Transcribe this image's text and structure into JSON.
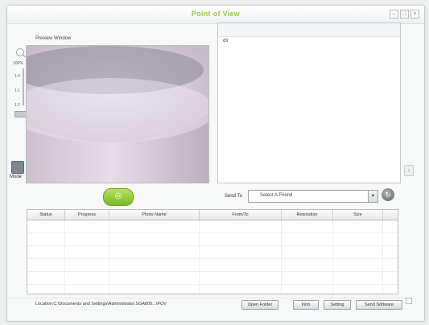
{
  "window": {
    "title": "Point of View"
  },
  "preview": {
    "label": "Preview Window"
  },
  "zoom": {
    "percent": "100%",
    "ticks": [
      "1:4",
      "1:1",
      "1:2"
    ]
  },
  "mode": {
    "label": "Mode"
  },
  "right_panel": {
    "header": "dir"
  },
  "send": {
    "label": "Send To",
    "selected": "Select A Friend"
  },
  "table": {
    "columns": [
      "Status",
      "Progress",
      "Photo Name",
      "From/To",
      "Resolution",
      "Size",
      ""
    ]
  },
  "status_bar": {
    "location": "Location:C:\\Documents and Settings\\Administrator.SGA800...\\POV",
    "buttons": [
      "Open Folder",
      "Intro",
      "Setting",
      "Send Software"
    ]
  },
  "colors": {
    "accent": "#9ac64a",
    "capture": "#7ab92c"
  }
}
